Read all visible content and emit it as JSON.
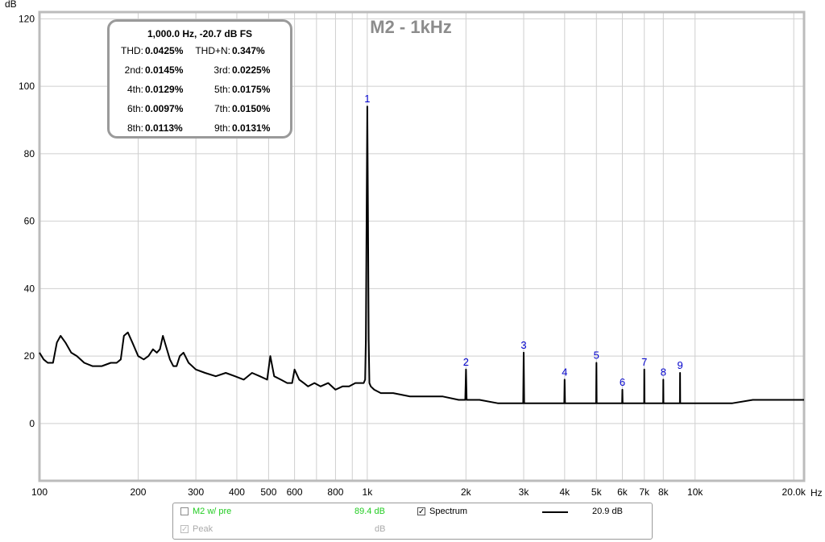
{
  "chart_data": {
    "type": "line",
    "title": "M2 - 1kHz",
    "ylabel": "dB",
    "x_unit_label": "Hz",
    "xscale": "log",
    "xlim": [
      100,
      21500
    ],
    "ylim": [
      -17,
      122
    ],
    "grid": true,
    "y_ticks": [
      0,
      20,
      40,
      60,
      80,
      100,
      120
    ],
    "x_ticks": [
      {
        "value": 100,
        "label": "100"
      },
      {
        "value": 200,
        "label": "200"
      },
      {
        "value": 300,
        "label": "300"
      },
      {
        "value": 400,
        "label": "400"
      },
      {
        "value": 500,
        "label": "500"
      },
      {
        "value": 600,
        "label": "600"
      },
      {
        "value": 800,
        "label": "800"
      },
      {
        "value": 1000,
        "label": "1k"
      },
      {
        "value": 2000,
        "label": "2k"
      },
      {
        "value": 3000,
        "label": "3k"
      },
      {
        "value": 4000,
        "label": "4k"
      },
      {
        "value": 5000,
        "label": "5k"
      },
      {
        "value": 6000,
        "label": "6k"
      },
      {
        "value": 7000,
        "label": "7k"
      },
      {
        "value": 8000,
        "label": "8k"
      },
      {
        "value": 10000,
        "label": "10k"
      },
      {
        "value": 20000,
        "label": "20.0k"
      }
    ],
    "minor_x_grid": [
      700,
      900
    ],
    "series": [
      {
        "color": "#000000",
        "x": [
          100,
          103,
          106,
          110,
          113,
          116,
          120,
          125,
          130,
          137,
          145,
          155,
          165,
          172,
          177,
          181,
          186,
          192,
          200,
          208,
          215,
          222,
          228,
          233,
          238,
          243,
          250,
          256,
          262,
          268,
          275,
          285,
          300,
          320,
          345,
          370,
          395,
          420,
          445,
          470,
          495,
          506,
          520,
          545,
          570,
          590,
          600,
          620,
          640,
          660,
          690,
          720,
          760,
          800,
          840,
          880,
          920,
          955,
          975,
          985,
          990,
          995,
          1000,
          1005,
          1010,
          1015,
          1025,
          1050,
          1100,
          1200,
          1350,
          1500,
          1700,
          1900,
          1990,
          2000,
          2010,
          2200,
          2500,
          2800,
          2990,
          3000,
          3010,
          3400,
          3800,
          3990,
          4000,
          4010,
          4500,
          4990,
          5000,
          5010,
          5500,
          5990,
          6000,
          6010,
          6500,
          6990,
          7000,
          7010,
          7500,
          7990,
          8000,
          8010,
          8500,
          8990,
          9000,
          9010,
          10000,
          11500,
          13000,
          15000,
          17000,
          19000,
          21500
        ],
        "y": [
          21,
          19,
          18,
          18,
          24,
          26,
          24,
          21,
          20,
          18,
          17,
          17,
          18,
          18,
          19,
          26,
          27,
          24,
          20,
          19,
          20,
          22,
          21,
          22,
          26,
          23,
          19,
          17,
          17,
          20,
          21,
          18,
          16,
          15,
          14,
          15,
          14,
          13,
          15,
          14,
          13,
          20,
          14,
          13,
          12,
          12,
          16,
          13,
          12,
          11,
          12,
          11,
          12,
          10,
          11,
          11,
          12,
          12,
          12,
          13,
          25,
          60,
          94,
          60,
          25,
          12,
          11,
          10,
          9,
          9,
          8,
          8,
          8,
          7,
          7,
          16,
          7,
          7,
          6,
          6,
          6,
          21,
          6,
          6,
          6,
          6,
          13,
          6,
          6,
          6,
          18,
          6,
          6,
          6,
          10,
          6,
          6,
          6,
          16,
          6,
          6,
          6,
          13,
          6,
          6,
          6,
          15,
          6,
          6,
          6,
          6,
          7,
          7,
          7,
          7
        ]
      }
    ],
    "harmonic_labels": [
      {
        "n": "1",
        "x": 1000,
        "y": 94
      },
      {
        "n": "2",
        "x": 2000,
        "y": 16
      },
      {
        "n": "3",
        "x": 3000,
        "y": 21
      },
      {
        "n": "4",
        "x": 4000,
        "y": 13
      },
      {
        "n": "5",
        "x": 5000,
        "y": 18
      },
      {
        "n": "6",
        "x": 6000,
        "y": 10
      },
      {
        "n": "7",
        "x": 7000,
        "y": 16
      },
      {
        "n": "8",
        "x": 8000,
        "y": 13
      },
      {
        "n": "9",
        "x": 9000,
        "y": 15
      }
    ],
    "harmonic_label_color": "#0000cc"
  },
  "info_box": {
    "title": "1,000.0 Hz, -20.7 dB FS",
    "rows": [
      [
        {
          "label": "THD:",
          "value": "0.0425%"
        },
        {
          "label": "THD+N:",
          "value": "0.347%"
        }
      ],
      [
        {
          "label": "2nd:",
          "value": "0.0145%"
        },
        {
          "label": "3rd:",
          "value": "0.0225%"
        }
      ],
      [
        {
          "label": "4th:",
          "value": "0.0129%"
        },
        {
          "label": "5th:",
          "value": "0.0175%"
        }
      ],
      [
        {
          "label": "6th:",
          "value": "0.0097%"
        },
        {
          "label": "7th:",
          "value": "0.0150%"
        }
      ],
      [
        {
          "label": "8th:",
          "value": "0.0113%"
        },
        {
          "label": "9th:",
          "value": "0.0131%"
        }
      ]
    ]
  },
  "legend": {
    "m2": {
      "label": "M2 w/ pre",
      "value": "89.4 dB",
      "color": "#22cc22"
    },
    "spectrum": {
      "label": "Spectrum",
      "value": "20.9 dB",
      "check": "✓"
    },
    "peak": {
      "label": "Peak",
      "value": "dB",
      "check": "✓"
    }
  }
}
